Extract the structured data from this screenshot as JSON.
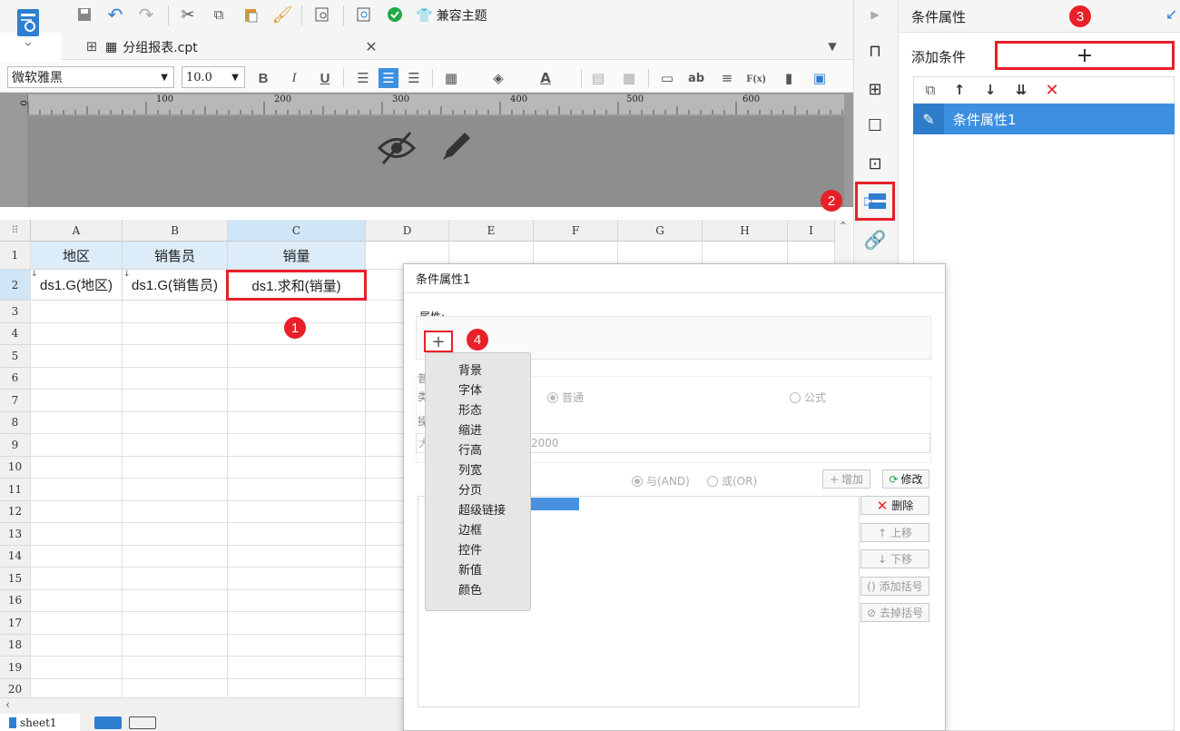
{
  "toolbar": {
    "compat_theme": "兼容主题"
  },
  "tab": {
    "filename": "分组报表.cpt"
  },
  "format": {
    "font": "微软雅黑",
    "size": "10.0",
    "bold": "B",
    "italic": "I",
    "underline": "U",
    "text_ab": "ab",
    "fx": "F(x)"
  },
  "ruler": {
    "labels": [
      "0",
      "100",
      "200",
      "300",
      "400",
      "500",
      "600"
    ]
  },
  "sheet": {
    "columns": [
      "A",
      "B",
      "C",
      "D",
      "E",
      "F",
      "G",
      "H",
      "I"
    ],
    "rows": [
      "1",
      "2",
      "3",
      "4",
      "5",
      "6",
      "7",
      "8",
      "9",
      "10",
      "11",
      "12",
      "13",
      "14",
      "15",
      "16",
      "17",
      "18",
      "19",
      "20"
    ],
    "header_cells": [
      "地区",
      "销售员",
      "销量"
    ],
    "data_cells": [
      "ds1.G(地区)",
      "ds1.G(销售员)",
      "ds1.求和(销量)"
    ],
    "tab_name": "sheet1"
  },
  "right_panel": {
    "title": "条件属性",
    "add_condition_label": "添加条件",
    "add_symbol": "+",
    "list_item": "条件属性1"
  },
  "dialog": {
    "title": "条件属性1",
    "property_label": "属性:",
    "menu_items": [
      "背景",
      "字体",
      "形态",
      "缩进",
      "行高",
      "列宽",
      "分页",
      "超级链接",
      "边框",
      "控件",
      "新值",
      "颜色"
    ],
    "radio_normal": "普通",
    "radio_formula": "公式",
    "value_text": "2000",
    "radio_and": "与(AND)",
    "radio_or": "或(OR)",
    "btn_add": "增加",
    "btn_modify": "修改",
    "btn_delete": "删除",
    "btn_up": "上移",
    "btn_down": "下移",
    "btn_add_bracket": "添加括号",
    "btn_remove_bracket": "去掉括号",
    "partial_labels": [
      "普",
      "类",
      "操",
      "大"
    ]
  },
  "badges": [
    "1",
    "2",
    "3",
    "4"
  ],
  "colors": {
    "accent_blue": "#3d8fe0",
    "highlight_red": "#e8202a",
    "header_cell_bg": "#dcecf8"
  }
}
